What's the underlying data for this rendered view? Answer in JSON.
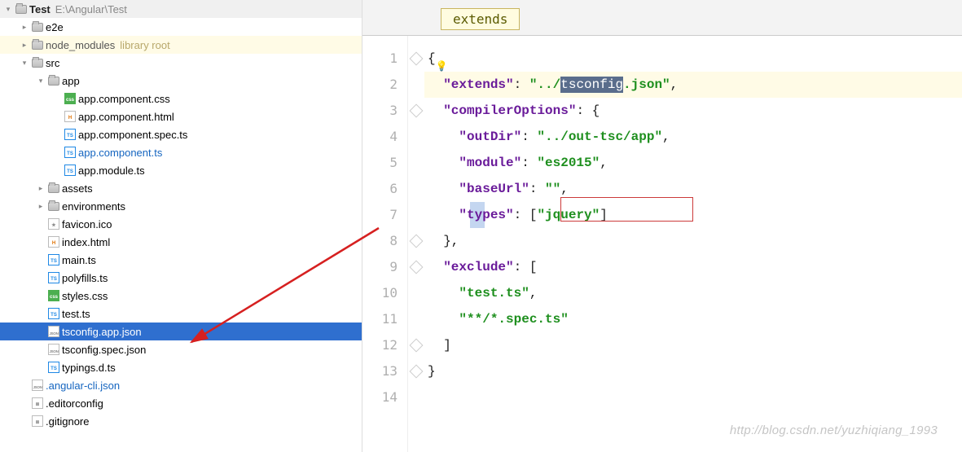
{
  "project": {
    "name": "Test",
    "path": "E:\\Angular\\Test"
  },
  "tree": [
    {
      "icon": "folder",
      "toggle": "closed",
      "indent": 1,
      "label": "e2e"
    },
    {
      "icon": "folder",
      "toggle": "closed",
      "indent": 1,
      "label": "node_modules",
      "lib": "library root",
      "highlighted": true
    },
    {
      "icon": "folder",
      "toggle": "open",
      "indent": 1,
      "label": "src"
    },
    {
      "icon": "folder",
      "toggle": "open",
      "indent": 2,
      "label": "app"
    },
    {
      "icon": "css",
      "toggle": "none",
      "indent": 3,
      "label": "app.component.css"
    },
    {
      "icon": "html",
      "toggle": "none",
      "indent": 3,
      "label": "app.component.html"
    },
    {
      "icon": "ts",
      "toggle": "none",
      "indent": 3,
      "label": "app.component.spec.ts"
    },
    {
      "icon": "ts",
      "toggle": "none",
      "indent": 3,
      "label": "app.component.ts",
      "link": true
    },
    {
      "icon": "ts",
      "toggle": "none",
      "indent": 3,
      "label": "app.module.ts"
    },
    {
      "icon": "folder",
      "toggle": "closed",
      "indent": 2,
      "label": "assets"
    },
    {
      "icon": "folder",
      "toggle": "closed",
      "indent": 2,
      "label": "environments"
    },
    {
      "icon": "ico",
      "toggle": "none",
      "indent": 2,
      "label": "favicon.ico"
    },
    {
      "icon": "html",
      "toggle": "none",
      "indent": 2,
      "label": "index.html"
    },
    {
      "icon": "ts",
      "toggle": "none",
      "indent": 2,
      "label": "main.ts"
    },
    {
      "icon": "ts",
      "toggle": "none",
      "indent": 2,
      "label": "polyfills.ts"
    },
    {
      "icon": "css",
      "toggle": "none",
      "indent": 2,
      "label": "styles.css"
    },
    {
      "icon": "ts",
      "toggle": "none",
      "indent": 2,
      "label": "test.ts"
    },
    {
      "icon": "json",
      "toggle": "none",
      "indent": 2,
      "label": "tsconfig.app.json",
      "selected": true
    },
    {
      "icon": "json",
      "toggle": "none",
      "indent": 2,
      "label": "tsconfig.spec.json"
    },
    {
      "icon": "ts",
      "toggle": "none",
      "indent": 2,
      "label": "typings.d.ts"
    },
    {
      "icon": "json",
      "toggle": "none",
      "indent": 1,
      "label": ".angular-cli.json",
      "link": true
    },
    {
      "icon": "cfg",
      "toggle": "none",
      "indent": 1,
      "label": ".editorconfig"
    },
    {
      "icon": "cfg",
      "toggle": "none",
      "indent": 1,
      "label": ".gitignore"
    }
  ],
  "tabHint": "extends",
  "code": {
    "line_numbers": [
      "1",
      "2",
      "3",
      "4",
      "5",
      "6",
      "7",
      "8",
      "9",
      "10",
      "11",
      "12",
      "13",
      "14"
    ],
    "extends_key": "\"extends\"",
    "extends_val_pre": "\"../",
    "extends_selected": "tsconfig",
    "extends_val_post": ".json\"",
    "compilerOptions_key": "\"compilerOptions\"",
    "outDir_key": "\"outDir\"",
    "outDir_val": "\"../out-tsc/app\"",
    "module_key": "\"module\"",
    "module_val": "\"es2015\"",
    "baseUrl_key": "\"baseUrl\"",
    "baseUrl_val": "\"\"",
    "types_key": "\"types\"",
    "types_val": "\"jquery\"",
    "exclude_key": "\"exclude\"",
    "exclude_val1": "\"test.ts\"",
    "exclude_val2": "\"**/*.spec.ts\""
  },
  "watermark": "http://blog.csdn.net/yuzhiqiang_1993"
}
